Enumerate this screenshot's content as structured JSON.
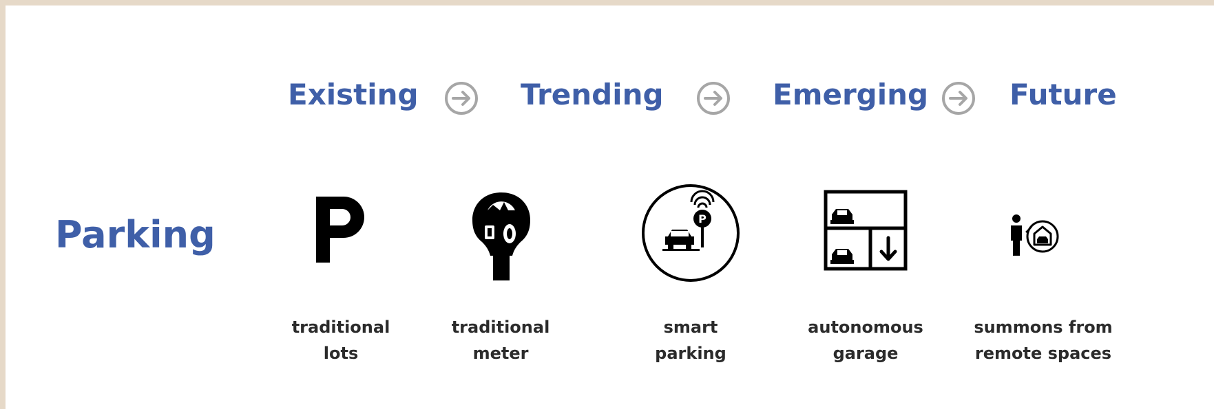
{
  "stages": [
    "Existing",
    "Trending",
    "Emerging",
    "Future"
  ],
  "row_label": "Parking",
  "items": [
    {
      "icon": "parking-p-icon",
      "line1": "traditional",
      "line2": "lots"
    },
    {
      "icon": "parking-meter-icon",
      "line1": "traditional",
      "line2": "meter"
    },
    {
      "icon": "smart-parking-icon",
      "line1": "smart",
      "line2": "parking"
    },
    {
      "icon": "autonomous-garage-icon",
      "line1": "autonomous",
      "line2": "garage"
    },
    {
      "icon": "summon-car-icon",
      "line1": "summons from",
      "line2": "remote spaces"
    }
  ],
  "colors": {
    "accent": "#3f5fa8",
    "arrow": "#a6a6a6",
    "icon": "#000000",
    "text": "#2b2b2b"
  }
}
